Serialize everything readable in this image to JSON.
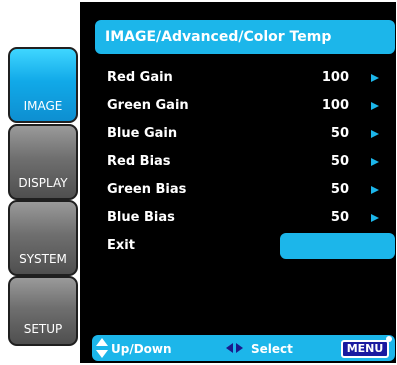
{
  "sidebar": {
    "tabs": [
      {
        "label": "IMAGE",
        "active": true
      },
      {
        "label": "DISPLAY",
        "active": false
      },
      {
        "label": "SYSTEM",
        "active": false
      },
      {
        "label": "SETUP",
        "active": false
      }
    ]
  },
  "header": {
    "title": "IMAGE/Advanced/Color Temp"
  },
  "menu": {
    "items": [
      {
        "label": "Red Gain",
        "value": "100"
      },
      {
        "label": "Green Gain",
        "value": "100"
      },
      {
        "label": "Blue Gain",
        "value": "50"
      },
      {
        "label": "Red Bias",
        "value": "50"
      },
      {
        "label": "Green Bias",
        "value": "50"
      },
      {
        "label": "Blue Bias",
        "value": "50"
      },
      {
        "label": "Exit",
        "value": ""
      }
    ]
  },
  "footer": {
    "updown_label": "Up/Down",
    "select_label": "Select",
    "menu_label": "MENU"
  },
  "colors": {
    "accent": "#1cb6ea",
    "background": "#000000",
    "tab_inactive": "#6f6f6f"
  },
  "icons": {
    "updown": "up-down-arrows-icon",
    "leftright": "left-right-arrows-icon",
    "value_arrow": "right-arrow-icon"
  }
}
